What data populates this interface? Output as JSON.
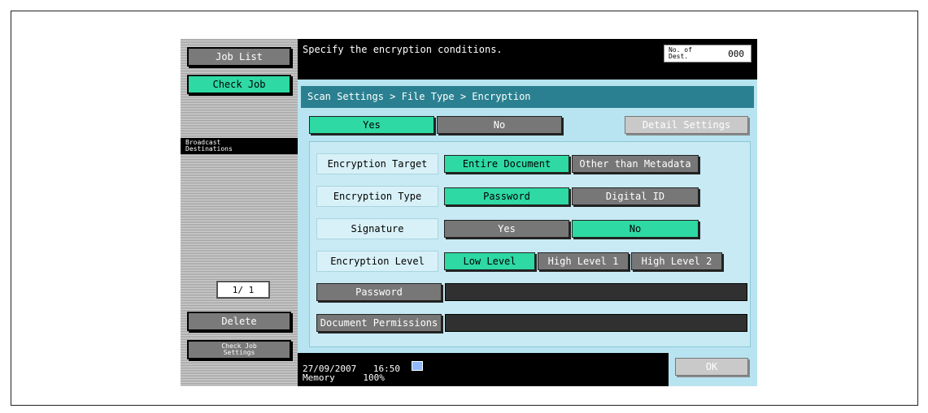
{
  "sidebar": {
    "job_list": "Job List",
    "check_job": "Check Job",
    "broadcast_line1": "Broadcast",
    "broadcast_line2": "Destinations",
    "page_counter": "1/  1",
    "delete": "Delete",
    "check_job_settings_line1": "Check Job",
    "check_job_settings_line2": "Settings"
  },
  "header": {
    "instruction": "Specify the encryption conditions.",
    "dest_label_line1": "No. of",
    "dest_label_line2": "Dest.",
    "dest_count": "000"
  },
  "breadcrumb": "Scan Settings > File Type > Encryption",
  "toggle": {
    "yes": "Yes",
    "no": "No",
    "selected": "yes"
  },
  "detail_settings": "Detail Settings",
  "rows": {
    "target": {
      "label": "Encryption Target",
      "opt1": "Entire Document",
      "opt2": "Other than Metadata"
    },
    "type": {
      "label": "Encryption Type",
      "opt1": "Password",
      "opt2": "Digital ID"
    },
    "signature": {
      "label": "Signature",
      "opt1": "Yes",
      "opt2": "No"
    },
    "level": {
      "label": "Encryption Level",
      "opt1": "Low Level",
      "opt2": "High Level 1",
      "opt3": "High Level 2"
    },
    "password": {
      "label": "Password",
      "value": ""
    },
    "permissions": {
      "label": "Document Permissions",
      "value": ""
    }
  },
  "status": {
    "date": "27/09/2007",
    "time": "16:50",
    "memory_label": "Memory",
    "memory_value": "100%"
  },
  "ok": "OK",
  "colors": {
    "selected": "#2ed9a3",
    "unselected": "#777777",
    "panel": "#b7e4f0",
    "breadcrumb": "#2a8090"
  }
}
